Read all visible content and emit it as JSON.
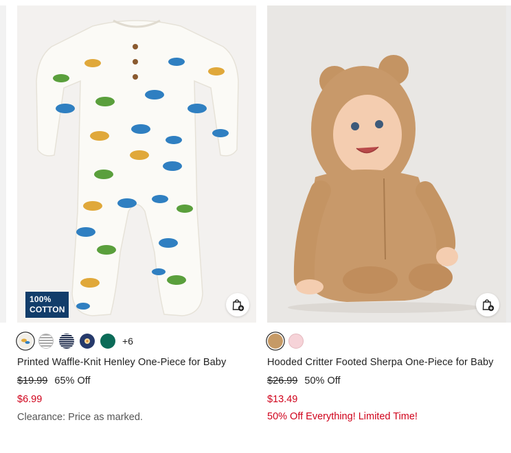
{
  "products": [
    {
      "title": "Printed Waffle-Knit Henley One-Piece for Baby",
      "original_price": "$19.99",
      "discount": "65% Off",
      "sale_price": "$6.99",
      "note": "Clearance: Price as marked.",
      "badge_line1": "100%",
      "badge_line2": "COTTON",
      "more_colors": "+6",
      "swatch_colors": [
        "#f2efe8",
        "#c8c8c8",
        "#1f2d4d",
        "#263a6b",
        "#0b6b58"
      ]
    },
    {
      "title": "Hooded Critter Footed Sherpa One-Piece for Baby",
      "original_price": "$26.99",
      "discount": "50% Off",
      "sale_price": "$13.49",
      "promo": "50% Off Everything! Limited Time!",
      "swatch_colors": [
        "#c69a66",
        "#f6d3d8"
      ]
    }
  ],
  "colors": {
    "sale_red": "#d0021b",
    "badge_navy": "#123d6a"
  }
}
